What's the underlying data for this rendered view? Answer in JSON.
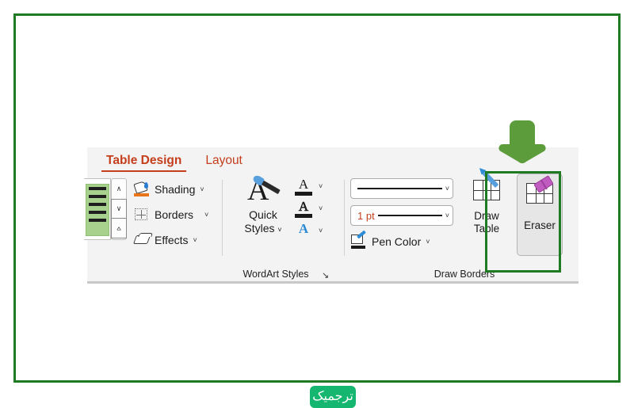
{
  "frame": {
    "border_color": "#1E7B23"
  },
  "ribbon": {
    "background": "#F3F3F3",
    "tabs": [
      {
        "label": "Table Design",
        "active": true
      },
      {
        "label": "Layout",
        "active": false
      }
    ],
    "active_tab_color": "#C43E1C",
    "groups": [
      {
        "name": "table-styles",
        "label": "",
        "gallery": {
          "scroll_up": "∧",
          "scroll_down": "∨",
          "more": "⩟",
          "swatch_color": "#A9D18E"
        }
      },
      {
        "name": "table-styles-menus",
        "label": "",
        "items": [
          {
            "label": "Shading",
            "icon": "paint-bucket-icon",
            "caret": "˅"
          },
          {
            "label": "Borders",
            "icon": "borders-grid-icon",
            "caret": "˅"
          },
          {
            "label": "Effects",
            "icon": "effects-3d-icon",
            "caret": "˅"
          }
        ]
      },
      {
        "name": "wordart-styles",
        "label": "WordArt Styles",
        "dialog_launcher": "↘",
        "quick_styles": {
          "line1": "Quick",
          "line2": "Styles",
          "caret": "˅",
          "icon": "letter-a-brush-icon"
        },
        "text_options": [
          {
            "name": "text-fill",
            "glyph": "A",
            "caret": "˅",
            "color": "#1A1A1A"
          },
          {
            "name": "text-outline",
            "glyph": "A",
            "caret": "˅",
            "color": "#1A1A1A"
          },
          {
            "name": "text-effects",
            "glyph": "A",
            "caret": "˅",
            "color": "#2E8BD6"
          }
        ]
      },
      {
        "name": "draw-borders",
        "label": "Draw Borders",
        "pen_style": {
          "value": "",
          "caret": "˅"
        },
        "pen_weight": {
          "value": "1 pt",
          "caret": "˅",
          "color": "#C43E1C"
        },
        "pen_color": {
          "label": "Pen Color",
          "caret": "˅",
          "icon": "pen-color-icon"
        },
        "draw_table": {
          "line1": "Draw",
          "line2": "Table",
          "icon": "draw-table-icon"
        },
        "eraser": {
          "label": "Eraser",
          "icon": "eraser-icon",
          "highlighted": true
        }
      }
    ]
  },
  "annotations": {
    "highlight_box": {
      "target": "eraser",
      "color": "#1E7B23"
    },
    "arrow": {
      "direction": "down",
      "color": "#5C9C3B",
      "points_to": "eraser"
    }
  },
  "footer": {
    "badge_text": "ترجمیک",
    "badge_color": "#15B66F"
  }
}
